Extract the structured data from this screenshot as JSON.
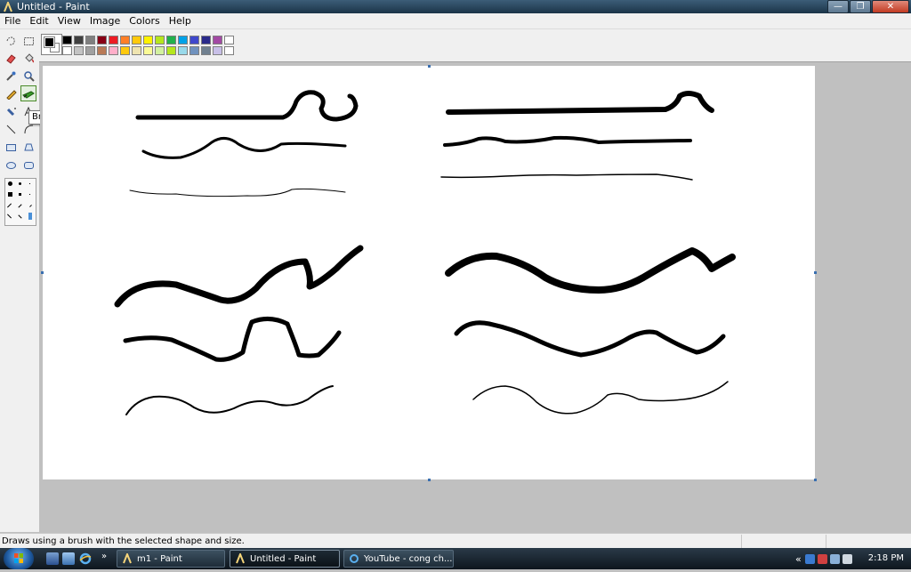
{
  "window": {
    "title": "Untitled - Paint",
    "controls": {
      "minimize": "—",
      "maximize": "❐",
      "close": "✕"
    }
  },
  "menu": [
    "File",
    "Edit",
    "View",
    "Image",
    "Colors",
    "Help"
  ],
  "palette": {
    "foreground": "#000000",
    "background": "#ffffff",
    "swatches": [
      "#000000",
      "#404040",
      "#7f7f7f",
      "#880015",
      "#ed1c24",
      "#ff7f27",
      "#ffc90e",
      "#fff200",
      "#b5e61d",
      "#22b14c",
      "#00a2e8",
      "#3f48cc",
      "#2a2a8a",
      "#a349a4",
      "#ffffff",
      "#ffffff",
      "#c3c3c3",
      "#a0a0a0",
      "#b97a57",
      "#ffaec9",
      "#ffc90e",
      "#efe4b0",
      "#fafa96",
      "#d2f0a0",
      "#b5e61d",
      "#99d9ea",
      "#7092be",
      "#708090",
      "#c8bfe7",
      "#ffffff"
    ]
  },
  "tooltip": "Brush",
  "status": {
    "text": "Draws using a brush with the selected shape and size."
  },
  "taskbar": {
    "tasks": [
      {
        "label": "m1 - Paint",
        "active": false
      },
      {
        "label": "Untitled - Paint",
        "active": true
      },
      {
        "label": "YouTube - cong ch...",
        "active": false
      }
    ],
    "clock": "2:18 PM",
    "chevron": "«",
    "quicklaunch_more": "»"
  }
}
